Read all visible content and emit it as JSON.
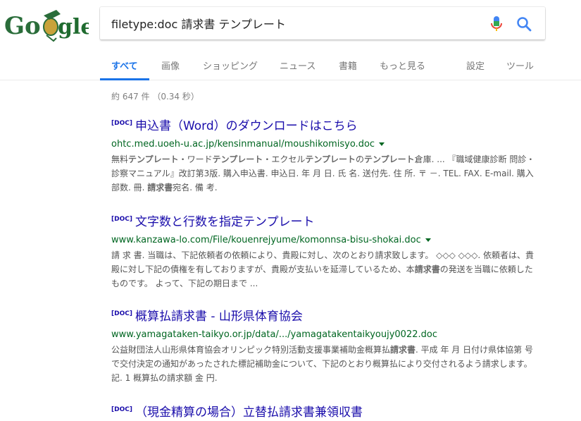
{
  "search": {
    "query": "filetype:doc 請求書 テンプレート",
    "mic_icon": "mic-icon",
    "search_icon": "magnifier-icon"
  },
  "logo": {
    "text": "Google",
    "colors": [
      "#2a6d3a",
      "#c8a23a",
      "#1f6b2f"
    ]
  },
  "tabs": [
    {
      "label": "すべて",
      "active": true
    },
    {
      "label": "画像"
    },
    {
      "label": "ショッピング"
    },
    {
      "label": "ニュース"
    },
    {
      "label": "書籍"
    },
    {
      "label": "もっと見る"
    },
    {
      "label": "設定"
    },
    {
      "label": "ツール"
    }
  ],
  "stats": "約 647 件 （0.34 秒）",
  "results": [
    {
      "tag": "[DOC]",
      "title": "申込書（Word）のダウンロードはこちら",
      "url": "ohtc.med.uoeh-u.ac.jp/kensinmanual/moushikomisyo.doc",
      "snippet": [
        {
          "t": "無料"
        },
        {
          "t": "テンプレート",
          "b": true
        },
        {
          "t": "・ワード"
        },
        {
          "t": "テンプレート",
          "b": true
        },
        {
          "t": "・エクセル"
        },
        {
          "t": "テンプレート",
          "b": true
        },
        {
          "t": "の"
        },
        {
          "t": "テンプレート",
          "b": true
        },
        {
          "t": "倉庫. ... 『職域健康診断 問診・診察マニュアル』改訂第3版. 購入申込書. 申込日. 年 月 日. 氏 名. 送付先. 住 所. 〒 －. TEL. FAX. E-mail. 購入部数. 冊. "
        },
        {
          "t": "請求書",
          "b": true
        },
        {
          "t": "宛名. 備 考."
        }
      ]
    },
    {
      "tag": "[DOC]",
      "title": "文字数と行数を指定テンプレート",
      "url": "www.kanzawa-lo.com/File/kouenrejyume/komonnsa-bisu-shokai.doc",
      "snippet": [
        {
          "t": "請 求 書. 当職は、下記依頼者の依頼により、貴殿に対し、次のとおり請求致します。 ◇◇◇ ◇◇◇. 依頼者は、貴殿に対し下記の債権を有しておりますが、貴殿が支払いを延滞しているため、本"
        },
        {
          "t": "請求書",
          "b": true
        },
        {
          "t": "の発送を当職に依頼したものです。 よって、下記の期日まで ..."
        }
      ]
    },
    {
      "tag": "[DOC]",
      "title": "概算払請求書 - 山形県体育協会",
      "url": "www.yamagataken-taikyo.or.jp/data/.../yamagatakentaikyoujy0022.doc",
      "snippet": [
        {
          "t": "公益財団法人山形県体育協会オリンピック特別活動支援事業補助金概算払"
        },
        {
          "t": "請求書",
          "b": true
        },
        {
          "t": ". 平成 年 月 日付け県体協第 号で交付決定の通知があったされた標記補助金について、下記のとおり概算払により交付されるよう請求します。 記. 1 概算払の請求額 金 円."
        }
      ]
    },
    {
      "tag": "[DOC]",
      "title": "（現金精算の場合）立替払請求書兼領収書",
      "url": "",
      "snippet": []
    }
  ]
}
